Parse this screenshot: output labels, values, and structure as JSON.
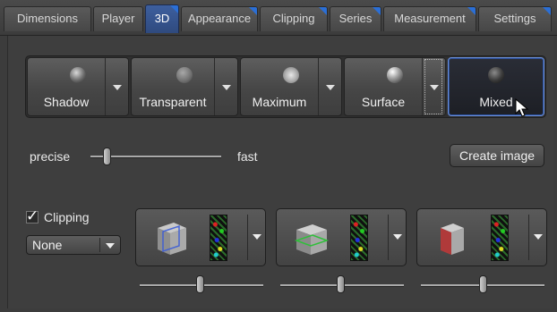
{
  "tabs": [
    {
      "label": "Dimensions",
      "active": false,
      "corner": false
    },
    {
      "label": "Player",
      "active": false,
      "corner": false
    },
    {
      "label": "3D",
      "active": true,
      "corner": true
    },
    {
      "label": "Appearance",
      "active": false,
      "corner": true
    },
    {
      "label": "Clipping",
      "active": false,
      "corner": true
    },
    {
      "label": "Series",
      "active": false,
      "corner": true
    },
    {
      "label": "Measurement",
      "active": false,
      "corner": true
    },
    {
      "label": "Settings",
      "active": false,
      "corner": true
    }
  ],
  "render_modes": [
    {
      "label": "Shadow",
      "icon": "shadow-sphere-icon",
      "has_dropdown": true,
      "selected": false
    },
    {
      "label": "Transparent",
      "icon": "transparent-sphere-icon",
      "has_dropdown": true,
      "selected": false
    },
    {
      "label": "Maximum",
      "icon": "maximum-sphere-icon",
      "has_dropdown": true,
      "selected": false
    },
    {
      "label": "Surface",
      "icon": "surface-sphere-icon",
      "has_dropdown": true,
      "selected": false
    },
    {
      "label": "Mixed",
      "icon": "mixed-sphere-icon",
      "has_dropdown": false,
      "selected": true
    }
  ],
  "quality": {
    "left_label": "precise",
    "right_label": "fast",
    "value": 0.1
  },
  "create_image_label": "Create image",
  "clipping": {
    "label": "Clipping",
    "checked": true,
    "check_glyph": "✓",
    "preset": "None",
    "planes": [
      {
        "icon": "clip-plane-cube-icon",
        "slider_value": 0.5
      },
      {
        "icon": "clip-plane-cube-icon",
        "slider_value": 0.5
      },
      {
        "icon": "clip-plane-cube-icon",
        "slider_value": 0.5
      }
    ]
  },
  "colors": {
    "accent": "#2b6fd6",
    "active_tab": "#3d5f9e"
  }
}
